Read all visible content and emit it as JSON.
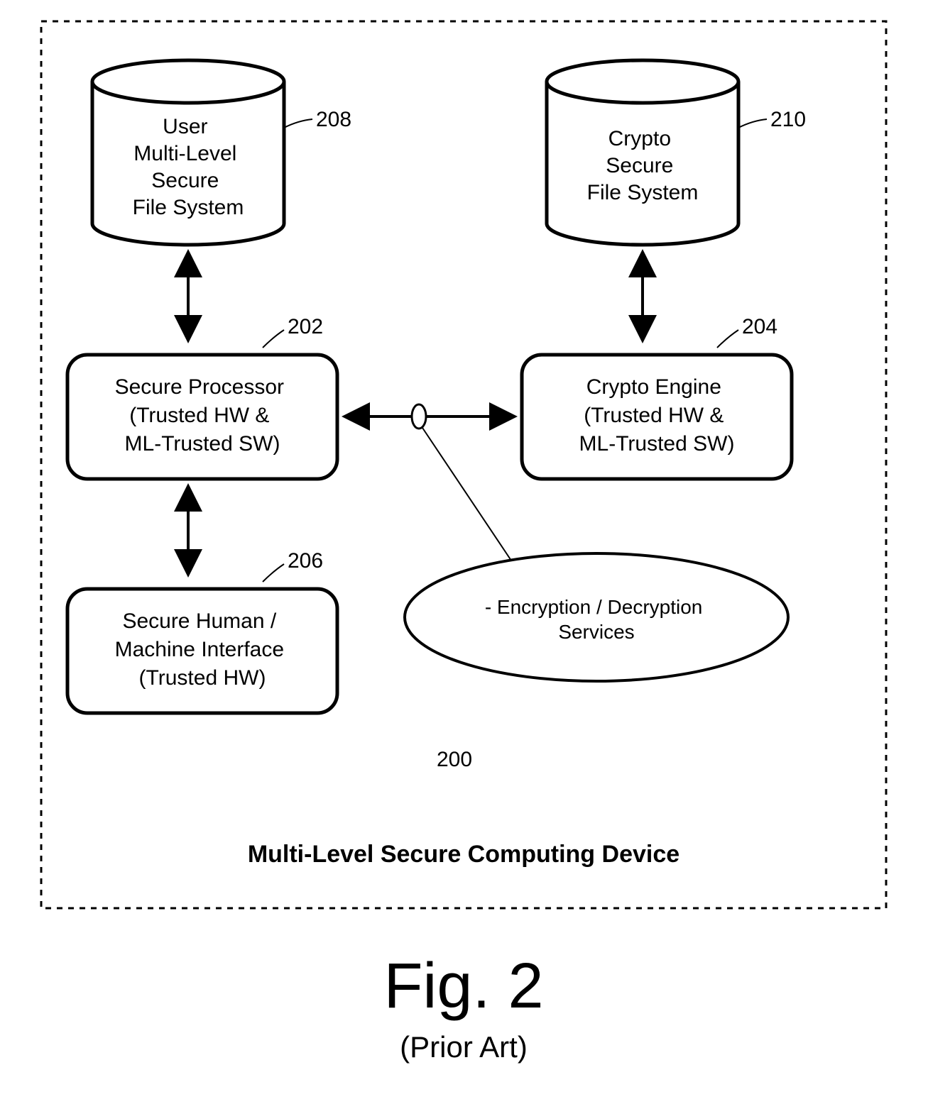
{
  "diagram": {
    "container_label": "Multi-Level Secure Computing Device",
    "container_ref": "200",
    "figure_label": "Fig. 2",
    "figure_sub": "(Prior Art)",
    "nodes": {
      "user_fs": {
        "ref": "208",
        "lines": [
          "User",
          "Multi-Level",
          "Secure",
          "File System"
        ]
      },
      "crypto_fs": {
        "ref": "210",
        "lines": [
          "Crypto",
          "Secure",
          "File System"
        ]
      },
      "secure_proc": {
        "ref": "202",
        "lines": [
          "Secure Processor",
          "(Trusted HW &",
          "ML-Trusted SW)"
        ]
      },
      "crypto_engine": {
        "ref": "204",
        "lines": [
          "Crypto Engine",
          "(Trusted HW &",
          "ML-Trusted SW)"
        ]
      },
      "hmi": {
        "ref": "206",
        "lines": [
          "Secure Human /",
          "Machine Interface",
          "(Trusted HW)"
        ]
      },
      "services": {
        "lines": [
          "- Encryption / Decryption",
          "Services"
        ]
      }
    }
  }
}
